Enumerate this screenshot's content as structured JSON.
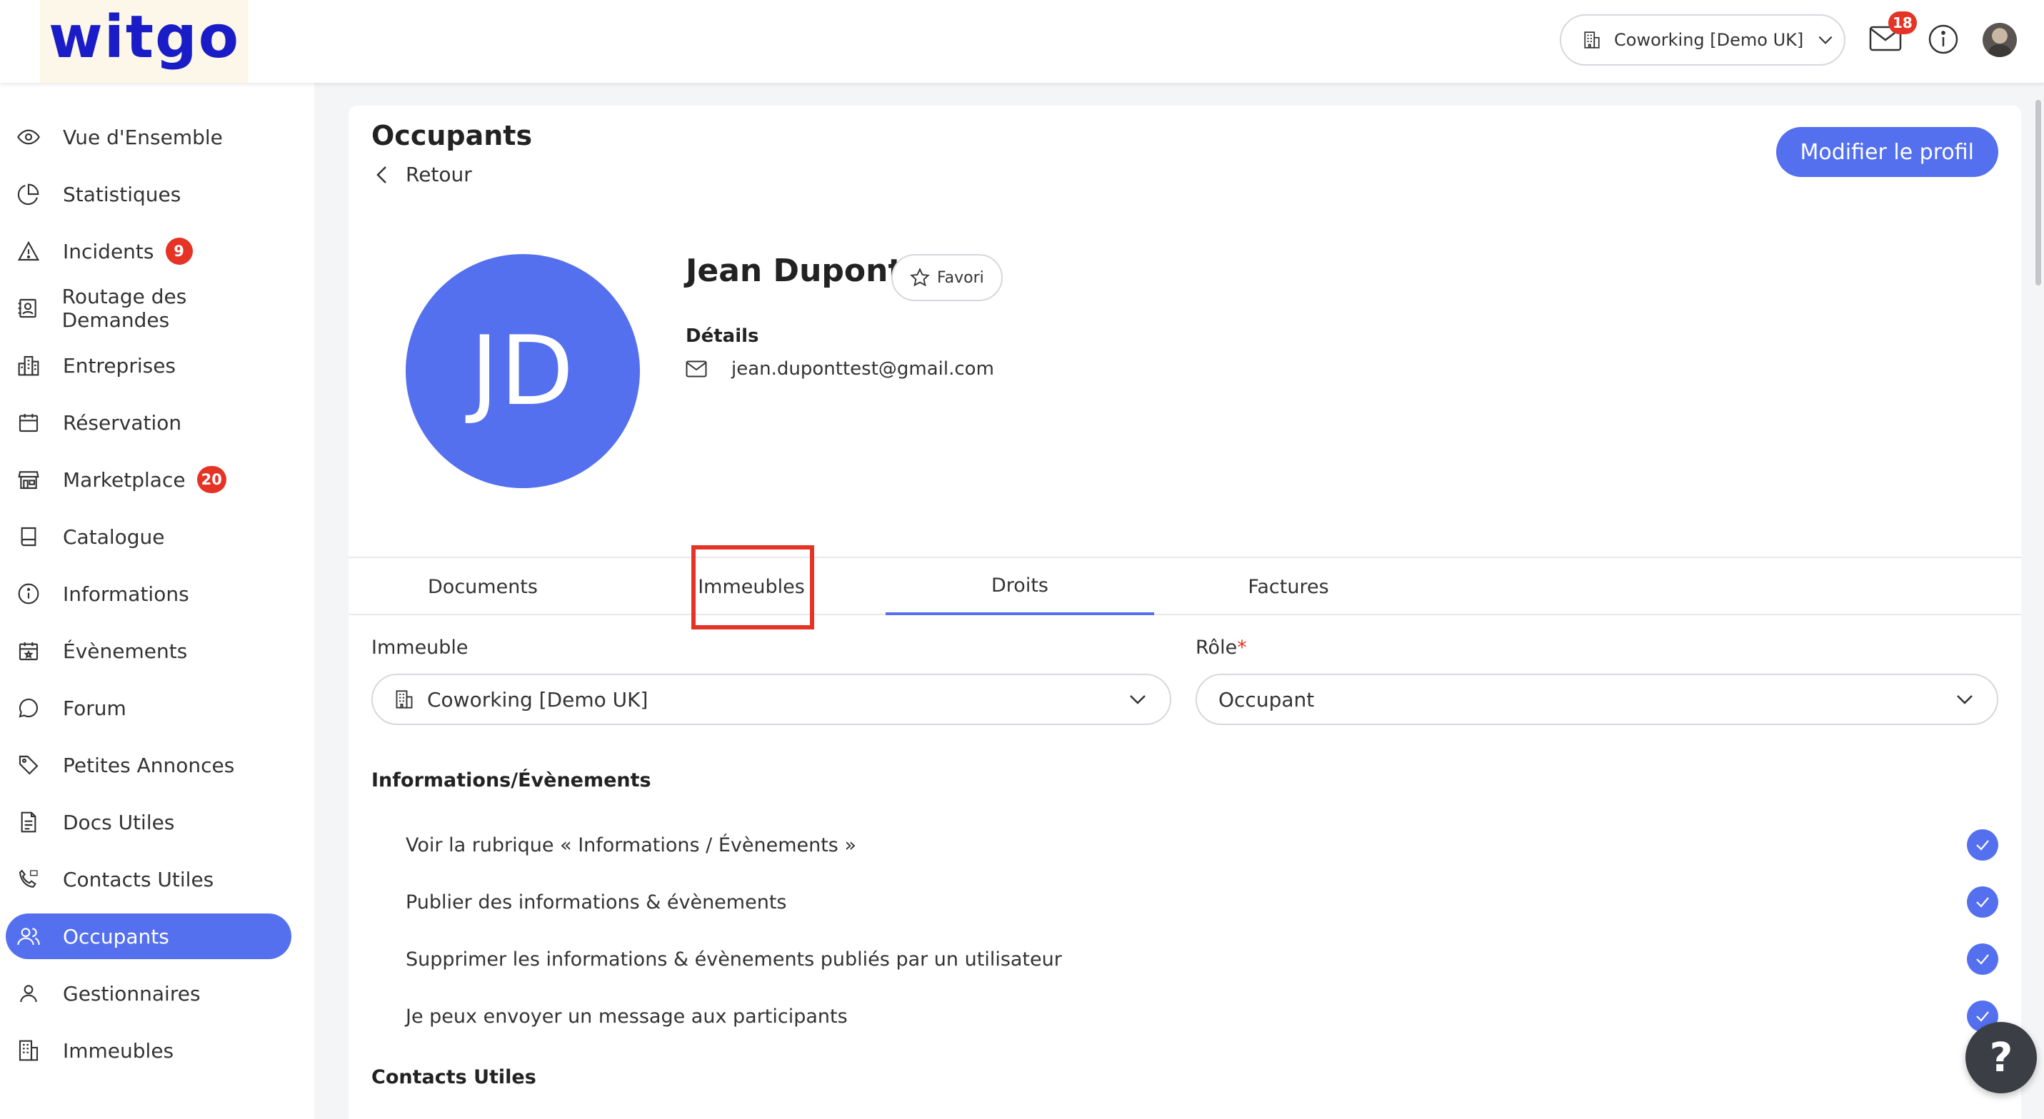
{
  "app": {
    "logo": "witgo"
  },
  "header": {
    "building_selector": "Coworking [Demo UK]",
    "mail_badge": "18"
  },
  "sidebar": {
    "items": [
      {
        "label": "Vue d'Ensemble",
        "icon": "eye-icon"
      },
      {
        "label": "Statistiques",
        "icon": "pie-chart-icon"
      },
      {
        "label": "Incidents",
        "icon": "warning-icon",
        "badge": "9"
      },
      {
        "label": "Routage des Demandes",
        "icon": "contact-card-icon"
      },
      {
        "label": "Entreprises",
        "icon": "city-icon"
      },
      {
        "label": "Réservation",
        "icon": "calendar-icon"
      },
      {
        "label": "Marketplace",
        "icon": "store-icon",
        "badge": "20"
      },
      {
        "label": "Catalogue",
        "icon": "book-icon"
      },
      {
        "label": "Informations",
        "icon": "info-icon"
      },
      {
        "label": "Évènements",
        "icon": "calendar-event-icon"
      },
      {
        "label": "Forum",
        "icon": "chat-bubble-icon"
      },
      {
        "label": "Petites Annonces",
        "icon": "tag-icon"
      },
      {
        "label": "Docs Utiles",
        "icon": "document-icon"
      },
      {
        "label": "Contacts Utiles",
        "icon": "phone-sos-icon"
      },
      {
        "label": "Occupants",
        "icon": "users-icon",
        "active": true
      },
      {
        "label": "Gestionnaires",
        "icon": "user-icon"
      },
      {
        "label": "Immeubles",
        "icon": "building-icon"
      }
    ]
  },
  "page": {
    "title": "Occupants",
    "back_label": "Retour",
    "edit_profile_label": "Modifier le profil"
  },
  "profile": {
    "initials": "JD",
    "name": "Jean Dupont",
    "favorite_label": "Favori",
    "details_label": "Détails",
    "email": "jean.duponttest@gmail.com"
  },
  "tabs": [
    {
      "label": "Documents"
    },
    {
      "label": "Immeubles",
      "highlighted": true
    },
    {
      "label": "Droits",
      "active": true
    },
    {
      "label": "Factures"
    }
  ],
  "rights": {
    "building_label": "Immeuble",
    "building_value": "Coworking [Demo UK]",
    "role_label": "Rôle",
    "role_required_mark": "*",
    "role_value": "Occupant",
    "sections": [
      {
        "title": "Informations/Évènements",
        "permissions": [
          {
            "label": "Voir la rubrique « Informations / Évènements »",
            "checked": true
          },
          {
            "label": "Publier des informations & évènements",
            "checked": true
          },
          {
            "label": "Supprimer les informations & évènements publiés par un utilisateur",
            "checked": true
          },
          {
            "label": "Je peux envoyer un message aux participants",
            "checked": true
          }
        ]
      },
      {
        "title": "Contacts Utiles",
        "permissions": []
      }
    ]
  },
  "help": {
    "label": "?"
  },
  "colors": {
    "accent": "#5470ee",
    "badge": "#e53326",
    "logo": "#1a1dc7"
  }
}
